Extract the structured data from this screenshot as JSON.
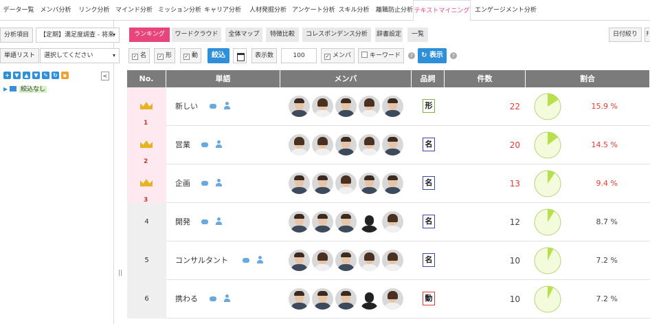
{
  "topnav": {
    "tabs": [
      {
        "label": "データ一覧",
        "active": false
      },
      {
        "label": "メンバ分析",
        "active": false
      },
      {
        "label": "リンク分析",
        "active": false
      },
      {
        "label": "マインド分析",
        "active": false
      },
      {
        "label": "ミッション分析",
        "active": false
      },
      {
        "label": "キャリア分析",
        "active": false
      },
      {
        "label": "人材発掘分析",
        "active": false
      },
      {
        "label": "アンケート分析",
        "active": false
      },
      {
        "label": "スキル分析",
        "active": false
      },
      {
        "label": "離職防止分析",
        "active": false
      },
      {
        "label": "テキストマイニング",
        "active": true
      },
      {
        "label": "エンゲージメント分析",
        "active": false
      }
    ]
  },
  "sidebar": {
    "analysis_label": "分析項目",
    "analysis_value": "【定期】満足度調査 - 将来",
    "wordlist_label": "単語リスト",
    "wordlist_value": "選択してください",
    "collapse_label": "<",
    "tree_node": "絞込なし",
    "handle": "||"
  },
  "subtabs": [
    {
      "label": "ランキング",
      "active": true
    },
    {
      "label": "ワードクラウド",
      "active": false
    },
    {
      "label": "全体マップ",
      "active": false
    },
    {
      "label": "特徴比較",
      "active": false
    },
    {
      "label": "コレスポンデンス分析",
      "active": false
    },
    {
      "label": "辞書設定",
      "active": false
    },
    {
      "label": "一覧",
      "active": false
    }
  ],
  "right_button": "日付絞り",
  "right_button2": "ﾁ",
  "filters": {
    "noun": "名",
    "adjective": "形",
    "verb": "動",
    "filter_button": "絞込",
    "display_count_label": "表示数",
    "display_count_value": "100",
    "member": "メンバ",
    "keyword": "キーワード",
    "show_button": "表示",
    "help": "?"
  },
  "table": {
    "headers": [
      "No.",
      "単語",
      "メンバ",
      "品詞",
      "件数",
      "割合"
    ],
    "rows": [
      {
        "no": "1",
        "rank_icon": "crown-1",
        "word": "新しい",
        "pos": "形",
        "pos_color": "#7cb342",
        "count": "22",
        "pct": "15.9 %",
        "pct_value": 15.9,
        "highlight": true,
        "avatars": [
          "man",
          "woman",
          "man",
          "woman",
          "man"
        ]
      },
      {
        "no": "2",
        "rank_icon": "crown-2",
        "word": "営業",
        "pos": "名",
        "pos_color": "#3949ab",
        "count": "20",
        "pct": "14.5 %",
        "pct_value": 14.5,
        "highlight": true,
        "avatars": [
          "woman",
          "woman",
          "man",
          "woman",
          "man"
        ]
      },
      {
        "no": "3",
        "rank_icon": "crown-3",
        "word": "企画",
        "pos": "名",
        "pos_color": "#3949ab",
        "count": "13",
        "pct": "9.4 %",
        "pct_value": 9.4,
        "highlight": true,
        "avatars": [
          "man",
          "man",
          "woman",
          "man",
          "man"
        ]
      },
      {
        "no": "4",
        "rank_icon": "",
        "word": "開発",
        "pos": "名",
        "pos_color": "#3949ab",
        "count": "12",
        "pct": "8.7 %",
        "pct_value": 8.7,
        "highlight": false,
        "avatars": [
          "man",
          "man",
          "man",
          "silhouette",
          "woman"
        ]
      },
      {
        "no": "5",
        "rank_icon": "",
        "word": "コンサルタント",
        "pos": "名",
        "pos_color": "#3949ab",
        "count": "10",
        "pct": "7.2 %",
        "pct_value": 7.2,
        "highlight": false,
        "avatars": [
          "man",
          "woman",
          "man",
          "woman",
          "woman"
        ]
      },
      {
        "no": "6",
        "rank_icon": "",
        "word": "携わる",
        "pos": "動",
        "pos_color": "#e53935",
        "count": "10",
        "pct": "7.2 %",
        "pct_value": 7.2,
        "highlight": false,
        "avatars": [
          "man",
          "man",
          "man",
          "silhouette",
          "woman"
        ]
      }
    ]
  },
  "colors": {
    "accent": "#e8457c",
    "primary": "#2f8fd8",
    "header": "#7b7b7b",
    "highlight_row": "#fde9ef",
    "pie_fill": "#b8e04a",
    "pie_bg": "#f4fbdc",
    "count_red": "#e53935"
  }
}
